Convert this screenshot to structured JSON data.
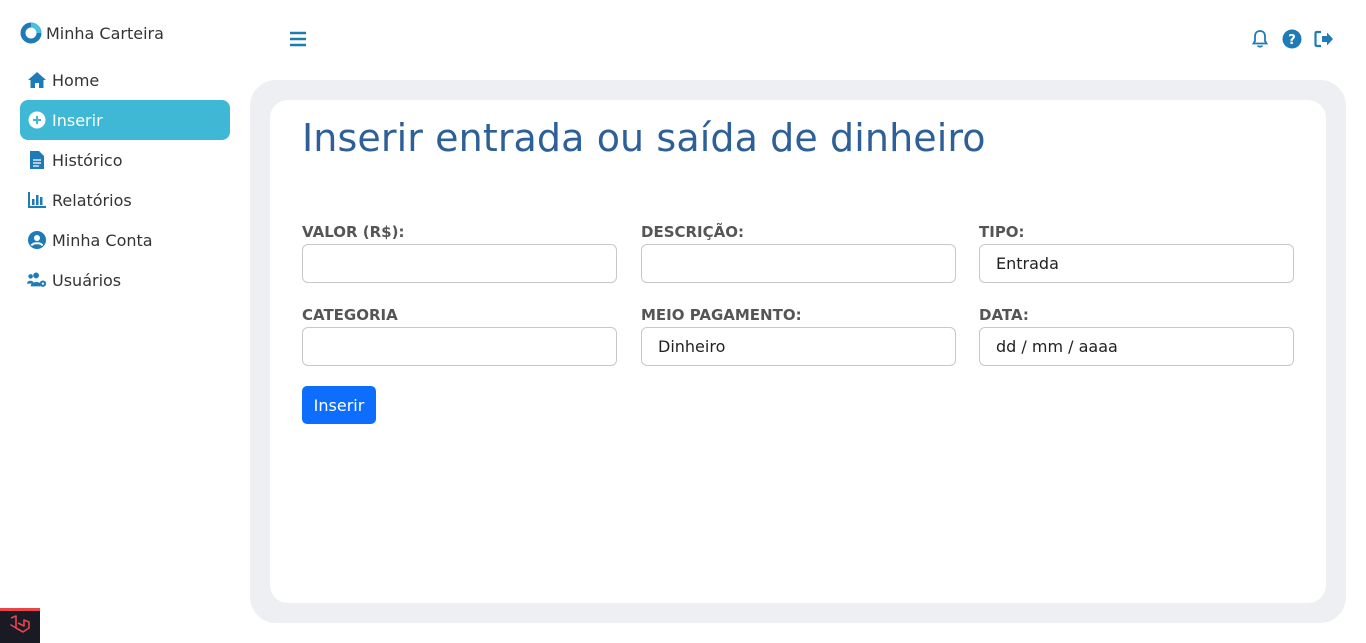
{
  "brand": {
    "name": "Minha Carteira",
    "icon": "donut-logo-icon"
  },
  "sidebar": {
    "items": [
      {
        "label": "Home",
        "icon": "home-icon",
        "active": false
      },
      {
        "label": "Inserir",
        "icon": "plus-circle-icon",
        "active": true
      },
      {
        "label": "Histórico",
        "icon": "file-icon",
        "active": false
      },
      {
        "label": "Relatórios",
        "icon": "bar-chart-icon",
        "active": false
      },
      {
        "label": "Minha Conta",
        "icon": "user-circle-icon",
        "active": false
      },
      {
        "label": "Usuários",
        "icon": "users-gear-icon",
        "active": false
      }
    ]
  },
  "topbar": {
    "menu_icon": "hamburger-icon",
    "icons": [
      "bell-icon",
      "help-icon",
      "logout-icon"
    ]
  },
  "form": {
    "title": "Inserir entrada ou saída de dinheiro",
    "fields": {
      "valor": {
        "label": "VALOR (R$):",
        "value": ""
      },
      "descricao": {
        "label": "DESCRIÇÃO:",
        "value": ""
      },
      "tipo": {
        "label": "TIPO:",
        "value": "Entrada"
      },
      "categoria": {
        "label": "CATEGORIA",
        "value": ""
      },
      "meio_pagamento": {
        "label": "MEIO PAGAMENTO:",
        "value": "Dinheiro"
      },
      "data": {
        "label": "DATA:",
        "value": "dd / mm / aaaa"
      }
    },
    "submit_label": "Inserir"
  },
  "colors": {
    "accent": "#3fb8d6",
    "title": "#2d5f98",
    "icon": "#1f7bb8",
    "button": "#0d6efd",
    "panel_bg": "#eeeff2"
  },
  "debug_badge": {
    "icon": "laravel-icon"
  }
}
